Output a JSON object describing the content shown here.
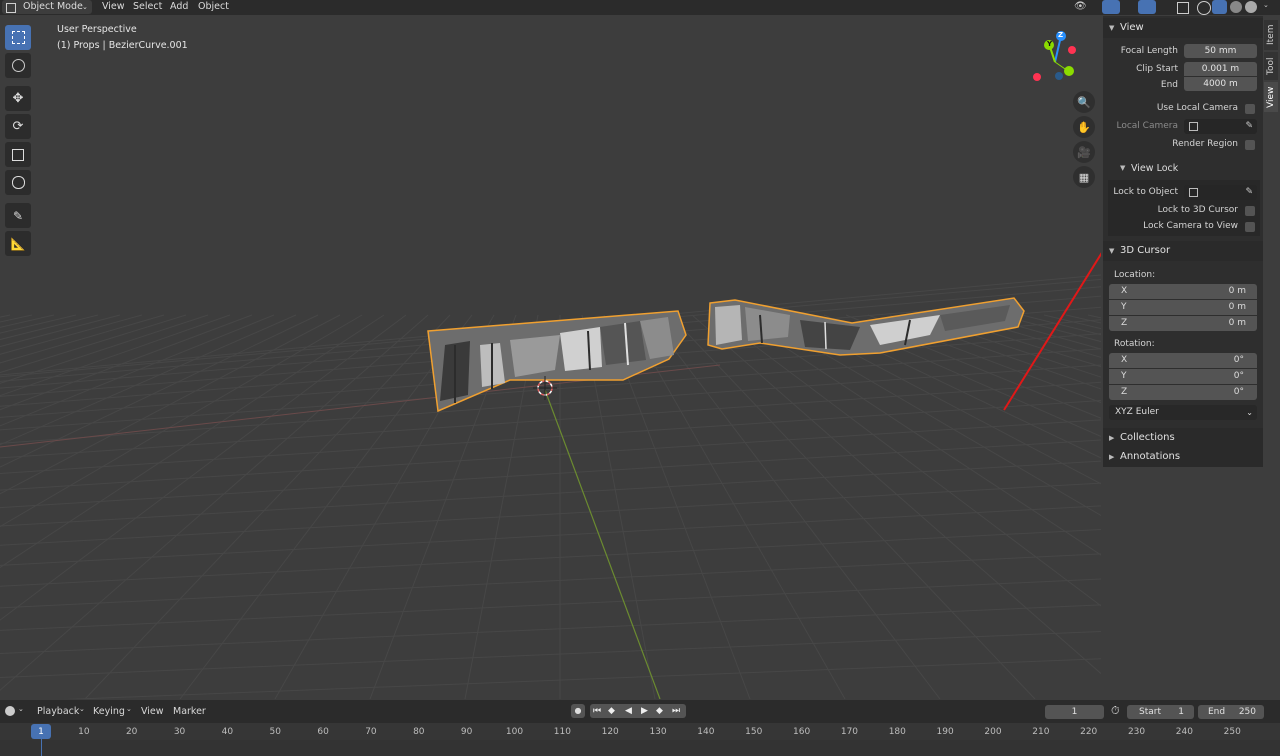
{
  "header": {
    "mode": "Object Mode",
    "menus": [
      "View",
      "Select",
      "Add",
      "Object"
    ]
  },
  "overlay": {
    "perspective": "User Perspective",
    "object_info": "(1) Props | BezierCurve.001"
  },
  "gizmo": {
    "z": "Z",
    "y": "Y"
  },
  "panel": {
    "tabs": [
      "Item",
      "Tool",
      "View"
    ],
    "view": {
      "title": "View",
      "focal_length_label": "Focal Length",
      "focal_length": "50 mm",
      "clip_start_label": "Clip Start",
      "clip_start": "0.001 m",
      "clip_end_label": "End",
      "clip_end": "4000 m",
      "use_local_camera": "Use Local Camera",
      "local_camera": "Local Camera",
      "render_region": "Render Region"
    },
    "view_lock": {
      "title": "View Lock",
      "lock_to_object": "Lock to Object",
      "lock_to_cursor": "Lock to 3D Cursor",
      "lock_camera": "Lock Camera to View"
    },
    "cursor": {
      "title": "3D Cursor",
      "location_label": "Location:",
      "x": "X",
      "y": "Y",
      "z": "Z",
      "loc_x": "0 m",
      "loc_y": "0 m",
      "loc_z": "0 m",
      "rotation_label": "Rotation:",
      "rot_x": "0°",
      "rot_y": "0°",
      "rot_z": "0°",
      "rotation_mode": "XYZ Euler"
    },
    "collections": "Collections",
    "annotations": "Annotations"
  },
  "timeline": {
    "menus": [
      "Playback",
      "Keying",
      "View",
      "Marker"
    ],
    "current_frame": "1",
    "start_label": "Start",
    "start": "1",
    "end_label": "End",
    "end": "250",
    "ticks": [
      "1",
      "10",
      "20",
      "30",
      "40",
      "50",
      "60",
      "70",
      "80",
      "90",
      "100",
      "110",
      "120",
      "130",
      "140",
      "150",
      "160",
      "170",
      "180",
      "190",
      "200",
      "210",
      "220",
      "230",
      "240",
      "250"
    ]
  },
  "colors": {
    "accent": "#4772b3",
    "selection_outline": "#f0a030",
    "annotation": "#e01818",
    "x_axis": "#ff3352",
    "y_axis": "#8bdc00",
    "z_axis": "#2890ff"
  }
}
